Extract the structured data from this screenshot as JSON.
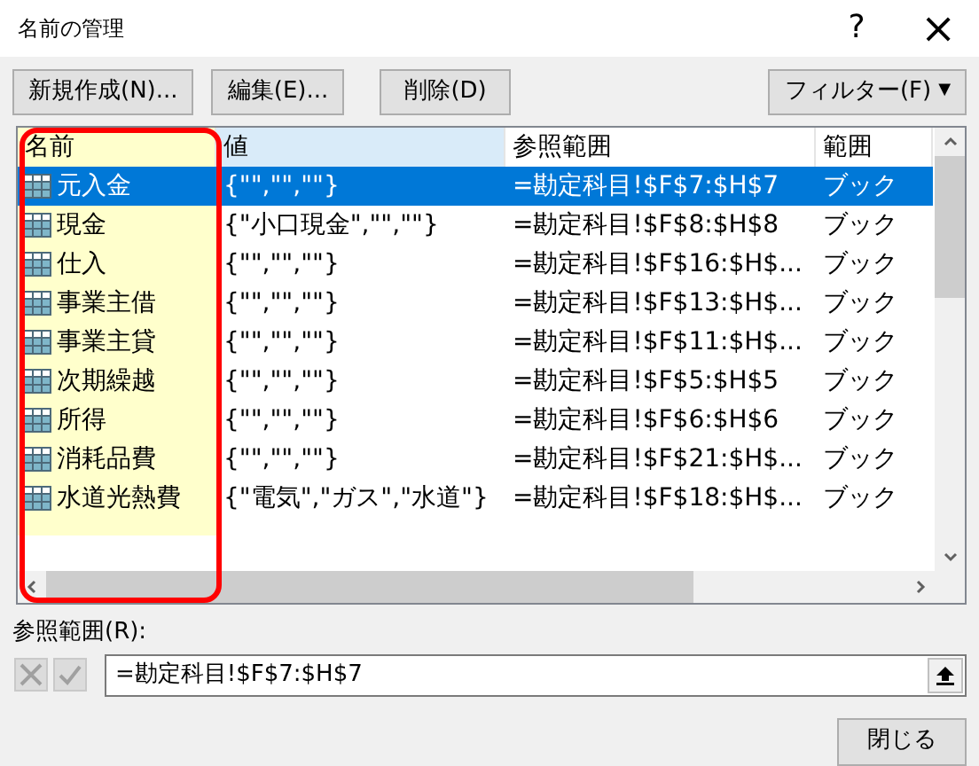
{
  "window": {
    "title": "名前の管理",
    "help": "?",
    "close": "×"
  },
  "toolbar": [
    {
      "label": "新規作成(N)..."
    },
    {
      "label": "編集(E)..."
    },
    {
      "label": "削除(D)"
    }
  ],
  "filter": {
    "label": "フィルター(F)",
    "caret": "▼"
  },
  "table": {
    "columns": [
      {
        "label": "名前",
        "highlighted": true,
        "hover": false
      },
      {
        "label": "値",
        "highlighted": false,
        "hover": true
      },
      {
        "label": "参照範囲",
        "highlighted": false,
        "hover": false
      },
      {
        "label": "範囲",
        "highlighted": false,
        "hover": false
      }
    ],
    "rows": [
      {
        "name": "元入金",
        "value": "{\"\",\"\",\"\"}",
        "ref": "=勘定科目!$F$7:$H$7",
        "scope": "ブック",
        "selected": true
      },
      {
        "name": "現金",
        "value": "{\"小口現金\",\"\",\"\"}",
        "ref": "=勘定科目!$F$8:$H$8",
        "scope": "ブック",
        "selected": false
      },
      {
        "name": "仕入",
        "value": "{\"\",\"\",\"\"}",
        "ref": "=勘定科目!$F$16:$H$...",
        "scope": "ブック",
        "selected": false
      },
      {
        "name": "事業主借",
        "value": "{\"\",\"\",\"\"}",
        "ref": "=勘定科目!$F$13:$H$...",
        "scope": "ブック",
        "selected": false
      },
      {
        "name": "事業主貸",
        "value": "{\"\",\"\",\"\"}",
        "ref": "=勘定科目!$F$11:$H$...",
        "scope": "ブック",
        "selected": false
      },
      {
        "name": "次期繰越",
        "value": "{\"\",\"\",\"\"}",
        "ref": "=勘定科目!$F$5:$H$5",
        "scope": "ブック",
        "selected": false
      },
      {
        "name": "所得",
        "value": "{\"\",\"\",\"\"}",
        "ref": "=勘定科目!$F$6:$H$6",
        "scope": "ブック",
        "selected": false
      },
      {
        "name": "消耗品費",
        "value": "{\"\",\"\",\"\"}",
        "ref": "=勘定科目!$F$21:$H$...",
        "scope": "ブック",
        "selected": false
      },
      {
        "name": "水道光熱費",
        "value": "{\"電気\",\"ガス\",\"水道\"}",
        "ref": "=勘定科目!$F$18:$H$...",
        "scope": "ブック",
        "selected": false
      }
    ]
  },
  "refers_to": {
    "label": "参照範囲(R):",
    "value": "=勘定科目!$F$7:$H$7",
    "cancel_disabled": true,
    "confirm_disabled": true
  },
  "close_button": {
    "label": "閉じる"
  }
}
